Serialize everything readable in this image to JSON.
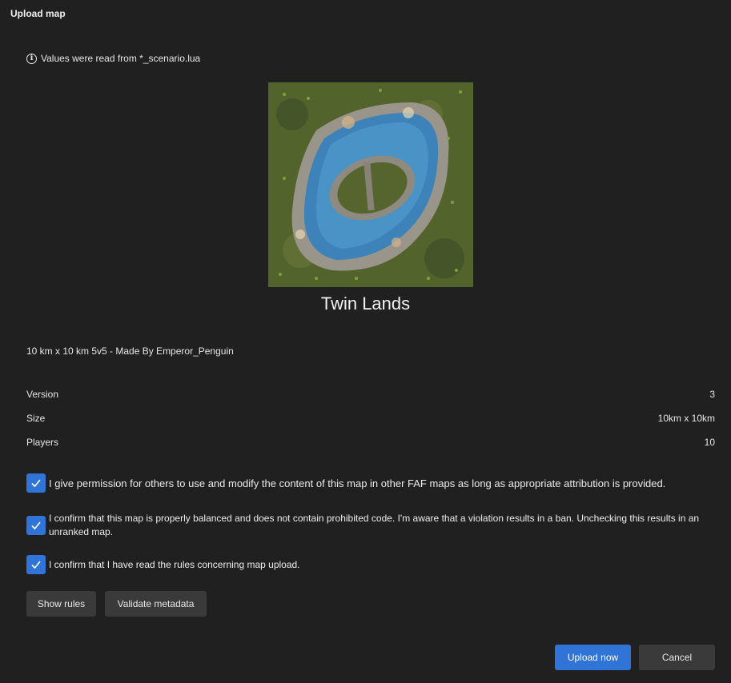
{
  "dialog": {
    "title": "Upload map"
  },
  "info": {
    "message": "Values were read from *_scenario.lua",
    "icon": "info-icon"
  },
  "map": {
    "name": "Twin Lands",
    "description": "10 km x 10 km 5v5 - Made By Emperor_Penguin",
    "properties": [
      {
        "label": "Version",
        "value": "3"
      },
      {
        "label": "Size",
        "value": "10km x 10km"
      },
      {
        "label": "Players",
        "value": "10"
      }
    ]
  },
  "checkboxes": [
    {
      "text": "I give permission for others to use and modify the content of this map in other FAF maps as long as appropriate attribution is provided.",
      "checked": true
    },
    {
      "text": "I confirm that this map is properly balanced and does not contain prohibited code. I'm aware that a violation results in a ban. Unchecking this results in an unranked map.",
      "checked": true
    },
    {
      "text": "I confirm that I have read the rules concerning map upload.",
      "checked": true
    }
  ],
  "buttons": {
    "show_rules": "Show rules",
    "validate_metadata": "Validate metadata",
    "upload_now": "Upload now",
    "cancel": "Cancel"
  },
  "colors": {
    "accent": "#2f74d6",
    "background": "#202020",
    "button": "#3a3a3a"
  }
}
